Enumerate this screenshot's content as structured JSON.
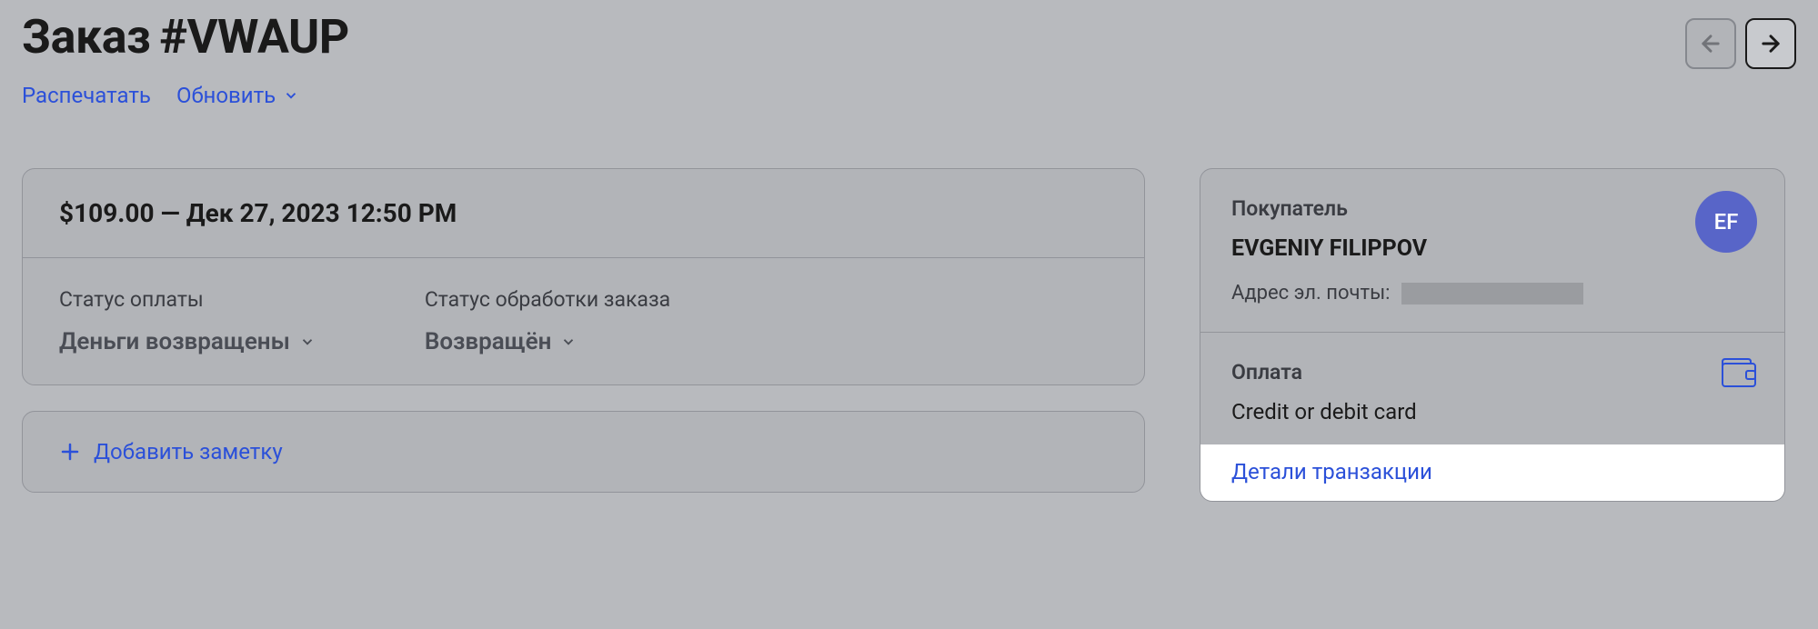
{
  "header": {
    "title_prefix": "Заказ",
    "order_id": "#VWAUP",
    "actions": {
      "print": "Распечатать",
      "update": "Обновить"
    }
  },
  "order": {
    "summary": "$109.00 — Дек 27, 2023 12:50 PM",
    "payment_status": {
      "label": "Статус оплаты",
      "value": "Деньги возвращены"
    },
    "fulfillment_status": {
      "label": "Статус обработки заказа",
      "value": "Возвращён"
    }
  },
  "notes": {
    "add_label": "Добавить заметку"
  },
  "buyer": {
    "section_label": "Покупатель",
    "name": "EVGENIY FILIPPOV",
    "email_label": "Адрес эл. почты:",
    "avatar_initials": "EF"
  },
  "payment": {
    "section_label": "Оплата",
    "method": "Credit or debit card",
    "transaction_link": "Детали транзакции"
  }
}
